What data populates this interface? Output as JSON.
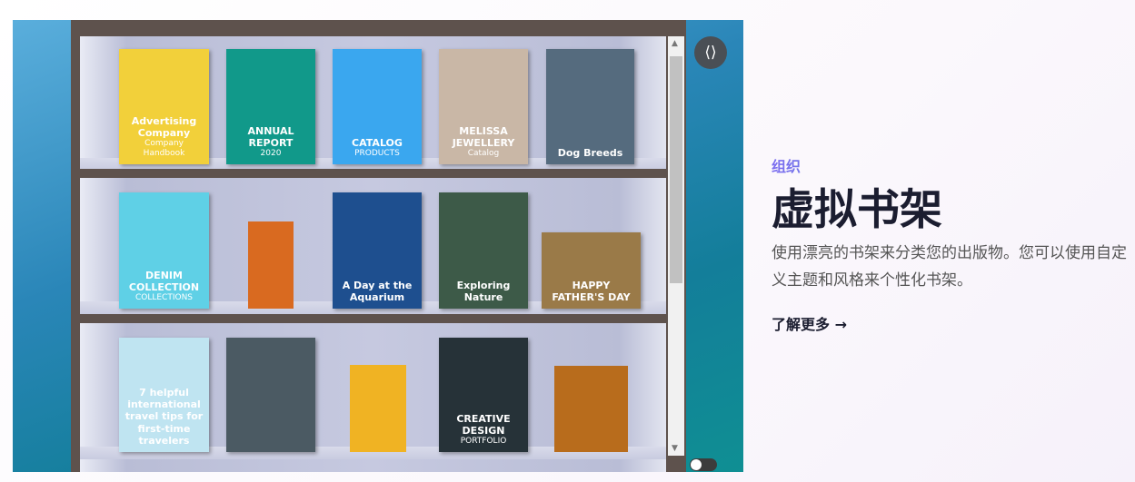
{
  "bookshelf": {
    "rows": [
      [
        {
          "title": "Advertising Company",
          "sub": "Company Handbook",
          "bg": "#f2d03a"
        },
        {
          "title": "ANNUAL REPORT",
          "sub": "2020",
          "bg": "#11998a"
        },
        {
          "title": "CATALOG",
          "sub": "PRODUCTS",
          "bg": "#3aa7ef"
        },
        {
          "title": "MELISSA JEWELLERY",
          "sub": "Catalog",
          "bg": "#c9b7a6"
        },
        {
          "title": "Dog Breeds",
          "sub": "",
          "bg": "#556b7e"
        }
      ],
      [
        {
          "title": "DENIM COLLECTION",
          "sub": "COLLECTIONS",
          "bg": "#5fd0e6"
        },
        {
          "title": "",
          "sub": "",
          "bg": "#d96a20"
        },
        {
          "title": "A Day at the Aquarium",
          "sub": "",
          "bg": "#1e4f8f"
        },
        {
          "title": "Exploring Nature",
          "sub": "",
          "bg": "#3d5a48"
        },
        {
          "title": "HAPPY FATHER'S DAY",
          "sub": "",
          "bg": "#9a7a48"
        }
      ],
      [
        {
          "title": "7 helpful international travel tips for first-time travelers",
          "sub": "",
          "bg": "#bfe4f1"
        },
        {
          "title": "",
          "sub": "",
          "bg": "#4b5a63"
        },
        {
          "title": "",
          "sub": "",
          "bg": "#f0b323"
        },
        {
          "title": "CREATIVE DESIGN",
          "sub": "PORTFOLIO",
          "bg": "#263238"
        },
        {
          "title": "",
          "sub": "",
          "bg": "#b86c1c"
        }
      ]
    ]
  },
  "share_icon": "share-icon",
  "right": {
    "category": "组织",
    "title": "虚拟书架",
    "description": "使用漂亮的书架来分类您的出版物。您可以使用自定义主题和风格来个性化书架。",
    "link": "了解更多 →"
  }
}
